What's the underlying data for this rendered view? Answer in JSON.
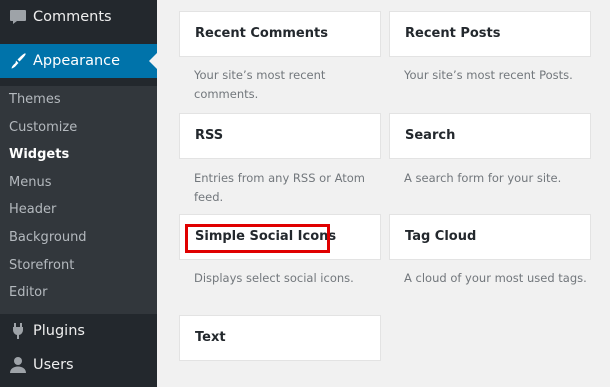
{
  "sidebar": {
    "comments": "Comments",
    "appearance": "Appearance",
    "submenu": [
      "Themes",
      "Customize",
      "Widgets",
      "Menus",
      "Header",
      "Background",
      "Storefront",
      "Editor"
    ],
    "plugins": "Plugins",
    "users": "Users"
  },
  "widgets": [
    {
      "title": "Recent Comments",
      "description": "Your site’s most recent comments."
    },
    {
      "title": "Recent Posts",
      "description": "Your site’s most recent Posts."
    },
    {
      "title": "RSS",
      "description": "Entries from any RSS or Atom feed."
    },
    {
      "title": "Search",
      "description": "A search form for your site."
    },
    {
      "title": "Simple Social Icons",
      "description": "Displays select social icons."
    },
    {
      "title": "Tag Cloud",
      "description": "A cloud of your most used tags."
    },
    {
      "title": "Text"
    }
  ],
  "colors": {
    "sidebar": "#23282d",
    "submenu": "#32373c",
    "accent": "#0073aa",
    "highlight": "#e00000"
  },
  "icons": [
    "comment-icon",
    "paintbrush-icon",
    "plug-icon",
    "user-icon"
  ]
}
